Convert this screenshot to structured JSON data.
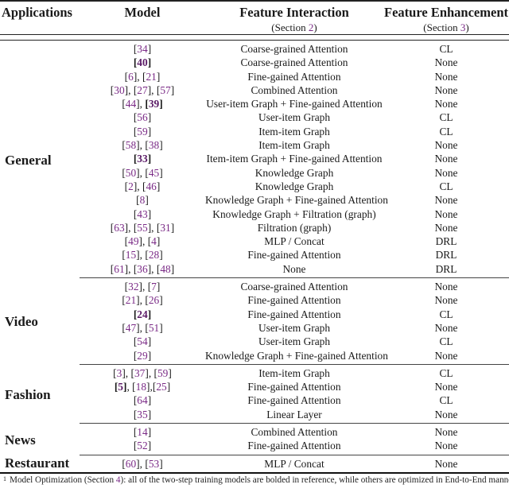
{
  "header": {
    "applications": "Applications",
    "model": "Model",
    "feature_interaction": "Feature Interaction",
    "feature_interaction_sub_prefix": "(Section ",
    "feature_interaction_sub_ref": "2",
    "feature_interaction_sub_suffix": ")",
    "feature_enhancement": "Feature Enhancement",
    "feature_enhancement_sub_prefix": "(Section ",
    "feature_enhancement_sub_ref": "3",
    "feature_enhancement_sub_suffix": ")"
  },
  "groups": [
    {
      "application": "General",
      "rows": [
        {
          "refs": [
            {
              "n": "34",
              "bold": false
            }
          ],
          "interaction": "Coarse-grained Attention",
          "enhancement": "CL"
        },
        {
          "refs": [
            {
              "n": "40",
              "bold": true
            }
          ],
          "interaction": "Coarse-grained Attention",
          "enhancement": "None"
        },
        {
          "refs": [
            {
              "n": "6",
              "bold": false
            },
            {
              "n": "21",
              "bold": false
            }
          ],
          "interaction": "Fine-gained Attention",
          "enhancement": "None"
        },
        {
          "refs": [
            {
              "n": "30",
              "bold": false
            },
            {
              "n": "27",
              "bold": false
            },
            {
              "n": "57",
              "bold": false
            }
          ],
          "interaction": "Combined Attention",
          "enhancement": "None"
        },
        {
          "refs": [
            {
              "n": "44",
              "bold": false
            },
            {
              "n": "39",
              "bold": true
            }
          ],
          "interaction": "User-item Graph + Fine-gained Attention",
          "enhancement": "None"
        },
        {
          "refs": [
            {
              "n": "56",
              "bold": false
            }
          ],
          "interaction": "User-item Graph",
          "enhancement": "CL"
        },
        {
          "refs": [
            {
              "n": "59",
              "bold": false
            }
          ],
          "interaction": "Item-item Graph",
          "enhancement": "CL"
        },
        {
          "refs": [
            {
              "n": "58",
              "bold": false
            },
            {
              "n": "38",
              "bold": false
            }
          ],
          "interaction": "Item-item Graph",
          "enhancement": "None"
        },
        {
          "refs": [
            {
              "n": "33",
              "bold": true
            }
          ],
          "interaction": "Item-item Graph + Fine-gained Attention",
          "enhancement": "None"
        },
        {
          "refs": [
            {
              "n": "50",
              "bold": false
            },
            {
              "n": "45",
              "bold": false
            }
          ],
          "interaction": "Knowledge Graph",
          "enhancement": "None"
        },
        {
          "refs": [
            {
              "n": "2",
              "bold": false
            },
            {
              "n": "46",
              "bold": false
            }
          ],
          "interaction": "Knowledge Graph",
          "enhancement": "CL"
        },
        {
          "refs": [
            {
              "n": "8",
              "bold": false
            }
          ],
          "interaction": "Knowledge Graph + Fine-gained Attention",
          "enhancement": "None"
        },
        {
          "refs": [
            {
              "n": "43",
              "bold": false
            }
          ],
          "interaction": "Knowledge Graph + Filtration (graph)",
          "enhancement": "None"
        },
        {
          "refs": [
            {
              "n": "63",
              "bold": false
            },
            {
              "n": "55",
              "bold": false
            },
            {
              "n": "31",
              "bold": false
            }
          ],
          "interaction": "Filtration (graph)",
          "enhancement": "None"
        },
        {
          "refs": [
            {
              "n": "49",
              "bold": false
            },
            {
              "n": "4",
              "bold": false
            }
          ],
          "interaction": "MLP / Concat",
          "enhancement": "DRL"
        },
        {
          "refs": [
            {
              "n": "15",
              "bold": false
            },
            {
              "n": "28",
              "bold": false
            }
          ],
          "interaction": "Fine-gained Attention",
          "enhancement": "DRL"
        },
        {
          "refs": [
            {
              "n": "61",
              "bold": false
            },
            {
              "n": "36",
              "bold": false
            },
            {
              "n": "48",
              "bold": false
            }
          ],
          "interaction": "None",
          "enhancement": "DRL"
        }
      ]
    },
    {
      "application": "Video",
      "rows": [
        {
          "refs": [
            {
              "n": "32",
              "bold": false
            },
            {
              "n": "7",
              "bold": false
            }
          ],
          "interaction": "Coarse-grained Attention",
          "enhancement": "None"
        },
        {
          "refs": [
            {
              "n": "21",
              "bold": false
            },
            {
              "n": "26",
              "bold": false
            }
          ],
          "interaction": "Fine-gained Attention",
          "enhancement": "None"
        },
        {
          "refs": [
            {
              "n": "24",
              "bold": true
            }
          ],
          "interaction": "Fine-gained Attention",
          "enhancement": "CL"
        },
        {
          "refs": [
            {
              "n": "47",
              "bold": false
            },
            {
              "n": "51",
              "bold": false
            }
          ],
          "interaction": "User-item Graph",
          "enhancement": "None"
        },
        {
          "refs": [
            {
              "n": "54",
              "bold": false
            }
          ],
          "interaction": "User-item Graph",
          "enhancement": "CL"
        },
        {
          "refs": [
            {
              "n": "29",
              "bold": false
            }
          ],
          "interaction": "Knowledge Graph + Fine-gained Attention",
          "enhancement": "None"
        }
      ]
    },
    {
      "application": "Fashion",
      "rows": [
        {
          "refs": [
            {
              "n": "3",
              "bold": false
            },
            {
              "n": "37",
              "bold": false
            },
            {
              "n": "59",
              "bold": false
            }
          ],
          "interaction": "Item-item Graph",
          "enhancement": "CL"
        },
        {
          "refs": [
            {
              "n": "5",
              "bold": true
            },
            {
              "n": "18",
              "bold": false
            },
            {
              "n": "25",
              "bold": false,
              "nospace": true
            }
          ],
          "interaction": "Fine-gained Attention",
          "enhancement": "None"
        },
        {
          "refs": [
            {
              "n": "64",
              "bold": false
            }
          ],
          "interaction": "Fine-gained Attention",
          "enhancement": "CL"
        },
        {
          "refs": [
            {
              "n": "35",
              "bold": false
            }
          ],
          "interaction": "Linear Layer",
          "enhancement": "None"
        }
      ]
    },
    {
      "application": "News",
      "rows": [
        {
          "refs": [
            {
              "n": "14",
              "bold": false
            }
          ],
          "interaction": "Combined Attention",
          "enhancement": "None"
        },
        {
          "refs": [
            {
              "n": "52",
              "bold": false
            }
          ],
          "interaction": "Fine-gained Attention",
          "enhancement": "None"
        }
      ]
    },
    {
      "application": "Restaurant",
      "rows": [
        {
          "refs": [
            {
              "n": "60",
              "bold": false
            },
            {
              "n": "53",
              "bold": false
            }
          ],
          "interaction": "MLP / Concat",
          "enhancement": "None"
        }
      ]
    }
  ],
  "footnote": {
    "marker": "1",
    "prefix": "Model Optimization (Section ",
    "ref": "4",
    "suffix": "): all of the two-step training models are bolded in reference, while others are optimized in End-to-End manner."
  },
  "colors": {
    "reference_link": "#7a2a86",
    "text": "#1a1a1a",
    "rule": "#222222"
  }
}
